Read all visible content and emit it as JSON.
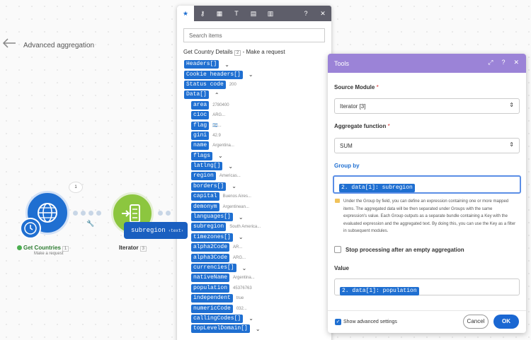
{
  "scenario": {
    "title": "Advanced aggregation"
  },
  "modules": {
    "get_countries": {
      "label": "Get Countries",
      "number": "1",
      "subtitle": "Make a request",
      "bubble": "1"
    },
    "iterator": {
      "label": "Iterator",
      "number": "3"
    }
  },
  "drag_pill": {
    "text": "subregion",
    "tag": "‹text›"
  },
  "mapping_panel": {
    "search_placeholder": "Search items",
    "header_prefix": "Get Country Details",
    "header_num": "2",
    "header_suffix": "- Make a request",
    "tabs": [
      "star-icon",
      "key-icon",
      "calculator-icon",
      "text-icon",
      "calendar-icon",
      "table-icon"
    ],
    "items": [
      {
        "key": "Headers[]",
        "value": "",
        "caret": "⌄",
        "indent": 0
      },
      {
        "key": "Cookie headers[]",
        "value": "",
        "caret": "⌄",
        "indent": 0
      },
      {
        "key": "Status code",
        "value": "200",
        "caret": "",
        "indent": 0
      },
      {
        "key": "Data[]",
        "value": "",
        "caret": "⌃",
        "indent": 0
      },
      {
        "key": "area",
        "value": "2780400",
        "caret": "",
        "indent": 1
      },
      {
        "key": "cioc",
        "value": "ARG...",
        "caret": "",
        "indent": 1
      },
      {
        "key": "flag",
        "value": "🇦🇷...",
        "caret": "",
        "indent": 1
      },
      {
        "key": "gini",
        "value": "42.9",
        "caret": "",
        "indent": 1
      },
      {
        "key": "name",
        "value": "Argentina...",
        "caret": "",
        "indent": 1
      },
      {
        "key": "flags",
        "value": "",
        "caret": "⌄",
        "indent": 1
      },
      {
        "key": "latlng[]",
        "value": "",
        "caret": "⌄",
        "indent": 1
      },
      {
        "key": "region",
        "value": "Americas...",
        "caret": "",
        "indent": 1
      },
      {
        "key": "borders[]",
        "value": "",
        "caret": "⌄",
        "indent": 1
      },
      {
        "key": "capital",
        "value": "Buenos Aires...",
        "caret": "",
        "indent": 1
      },
      {
        "key": "demonym",
        "value": "Argentinean...",
        "caret": "",
        "indent": 1
      },
      {
        "key": "languages[]",
        "value": "",
        "caret": "⌄",
        "indent": 1
      },
      {
        "key": "subregion",
        "value": "South America...",
        "caret": "",
        "indent": 1
      },
      {
        "key": "timezones[]",
        "value": "",
        "caret": "⌄",
        "indent": 1
      },
      {
        "key": "alpha2Code",
        "value": "AR...",
        "caret": "",
        "indent": 1
      },
      {
        "key": "alpha3Code",
        "value": "ARG...",
        "caret": "",
        "indent": 1
      },
      {
        "key": "currencies[]",
        "value": "",
        "caret": "⌄",
        "indent": 1
      },
      {
        "key": "nativeName",
        "value": "Argentina...",
        "caret": "",
        "indent": 1
      },
      {
        "key": "population",
        "value": "45376763",
        "caret": "",
        "indent": 1
      },
      {
        "key": "independent",
        "value": "true",
        "caret": "",
        "indent": 1
      },
      {
        "key": "numericCode",
        "value": "032...",
        "caret": "",
        "indent": 1
      },
      {
        "key": "callingCodes[]",
        "value": "",
        "caret": "⌄",
        "indent": 1
      },
      {
        "key": "topLevelDomain[]",
        "value": "",
        "caret": "⌄",
        "indent": 1
      }
    ]
  },
  "tools": {
    "title": "Tools",
    "source_module": {
      "label": "Source Module",
      "required": "*",
      "value": "Iterator [3]"
    },
    "aggregate_function": {
      "label": "Aggregate function",
      "required": "*",
      "value": "SUM"
    },
    "group_by": {
      "label": "Group by",
      "value": "2. data[1]: subregion"
    },
    "help": "Under the Group by field, you can define an expression containing one or more mapped items. The aggregated data will be then separated under Groups with the same expression's value. Each Group outputs as a separate bundle containing a Key with the evaluated expression and the aggregated text. By doing this, you can use the Key as a filter in subsequent modules.",
    "stop_processing": "Stop processing after an empty aggregation",
    "value": {
      "label": "Value",
      "value": "2. data[1]: population"
    },
    "show_advanced": "Show advanced settings",
    "cancel": "Cancel",
    "ok": "OK"
  }
}
